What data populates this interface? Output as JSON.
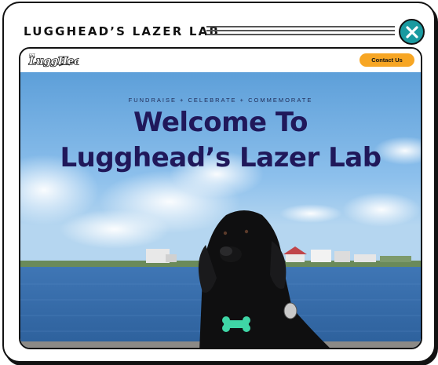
{
  "modal": {
    "title": "LUGGHEAD’S LAZER LAB",
    "close_icon": "close-icon"
  },
  "site": {
    "logo_text": "LuggHead",
    "logo_small": "EST.",
    "contact_label": "Contact Us"
  },
  "hero": {
    "tagline": "FUNDRAISE + CELEBRATE + COMMEMORATE",
    "headline_line1": "Welcome To",
    "headline_line2": "Lugghead’s Lazer Lab"
  },
  "colors": {
    "accent_teal": "#1a9aa0",
    "contact_orange": "#f7a624",
    "headline_navy": "#20185a"
  }
}
